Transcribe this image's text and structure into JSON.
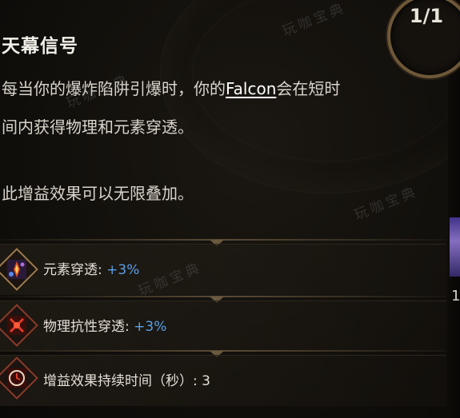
{
  "counter": "1/1",
  "title": "天幕信号",
  "description": {
    "line1_prefix": "每当你的爆炸陷阱引爆时，你的",
    "falcon_link": "Falcon",
    "line1_suffix": "会在短时",
    "line2": "间内获得物理和元素穿透。",
    "line3": "此增益效果可以无限叠加。"
  },
  "stats": [
    {
      "label": "元素穿透: ",
      "value": "+3%",
      "icon": "elemental-penetration-icon",
      "value_color": "#5aa0e8"
    },
    {
      "label": "物理抗性穿透: ",
      "value": "+3%",
      "icon": "physical-penetration-icon",
      "value_color": "#5aa0e8"
    },
    {
      "label": "增益效果持续时间（秒）: ",
      "value": "3",
      "icon": "duration-clock-icon",
      "value_color": "#e4dfd6"
    }
  ],
  "right_edge_text": "1",
  "watermarks": [
    "玩咖宝典",
    "玩咖宝典",
    "玩咖宝典",
    "玩咖宝典"
  ]
}
